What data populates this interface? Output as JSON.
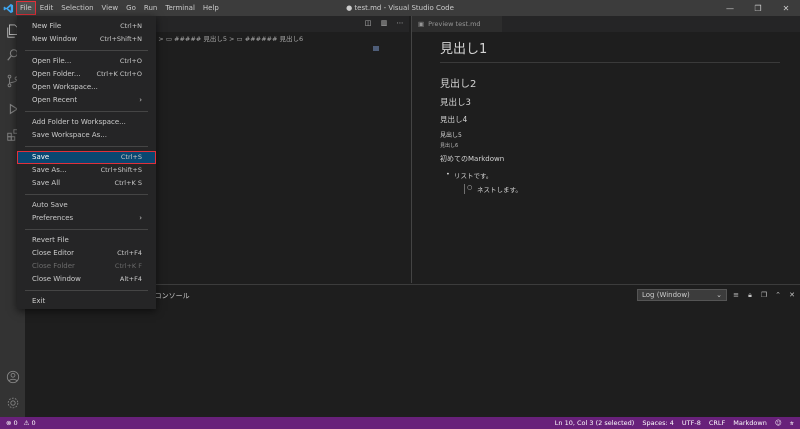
{
  "window": {
    "title": "● test.md - Visual Studio Code"
  },
  "menubar": {
    "items": [
      "File",
      "Edit",
      "Selection",
      "View",
      "Go",
      "Run",
      "Terminal",
      "Help"
    ]
  },
  "file_menu": {
    "groups": [
      [
        {
          "label": "New File",
          "shortcut": "Ctrl+N"
        },
        {
          "label": "New Window",
          "shortcut": "Ctrl+Shift+N"
        }
      ],
      [
        {
          "label": "Open File...",
          "shortcut": "Ctrl+O"
        },
        {
          "label": "Open Folder...",
          "shortcut": "Ctrl+K Ctrl+O"
        },
        {
          "label": "Open Workspace...",
          "shortcut": ""
        },
        {
          "label": "Open Recent",
          "shortcut": "",
          "submenu": true
        }
      ],
      [
        {
          "label": "Add Folder to Workspace...",
          "shortcut": ""
        },
        {
          "label": "Save Workspace As...",
          "shortcut": ""
        }
      ],
      [
        {
          "label": "Save",
          "shortcut": "Ctrl+S",
          "selected": true
        },
        {
          "label": "Save As...",
          "shortcut": "Ctrl+Shift+S"
        },
        {
          "label": "Save All",
          "shortcut": "Ctrl+K S"
        }
      ],
      [
        {
          "label": "Auto Save",
          "shortcut": ""
        },
        {
          "label": "Preferences",
          "shortcut": "",
          "submenu": true
        }
      ],
      [
        {
          "label": "Revert File",
          "shortcut": ""
        },
        {
          "label": "Close Editor",
          "shortcut": "Ctrl+F4"
        },
        {
          "label": "Close Folder",
          "shortcut": "Ctrl+K F",
          "disabled": true
        },
        {
          "label": "Close Window",
          "shortcut": "Alt+F4"
        }
      ],
      [
        {
          "label": "Exit",
          "shortcut": ""
        }
      ]
    ]
  },
  "editor": {
    "breadcrumb": "2 > ▭ ### 見出し3 > ▭ #### 見出し4 > ▭ ##### 見出し5 > ▭ ###### 見出し6"
  },
  "preview": {
    "tab_label": "Preview test.md",
    "h1": "見出し1",
    "h2": "見出し2",
    "h3": "見出し3",
    "h4": "見出し4",
    "h5": "見出し5",
    "h6": "見出し6",
    "paragraph": "初めてのMarkdown",
    "list_item": "リストです。",
    "nested_item": "ネストします。"
  },
  "panel": {
    "tab_label": "/ コンソール",
    "select_value": "Log (Window)"
  },
  "statusbar": {
    "errors": "⊗ 0",
    "warnings": "⚠ 0",
    "position": "Ln 10, Col 3 (2 selected)",
    "spaces": "Spaces: 4",
    "encoding": "UTF-8",
    "eol": "CRLF",
    "language": "Markdown"
  },
  "colors": {
    "statusbar": "#68217a",
    "menu_selected": "#094771",
    "highlight_box": "#e0303a"
  }
}
